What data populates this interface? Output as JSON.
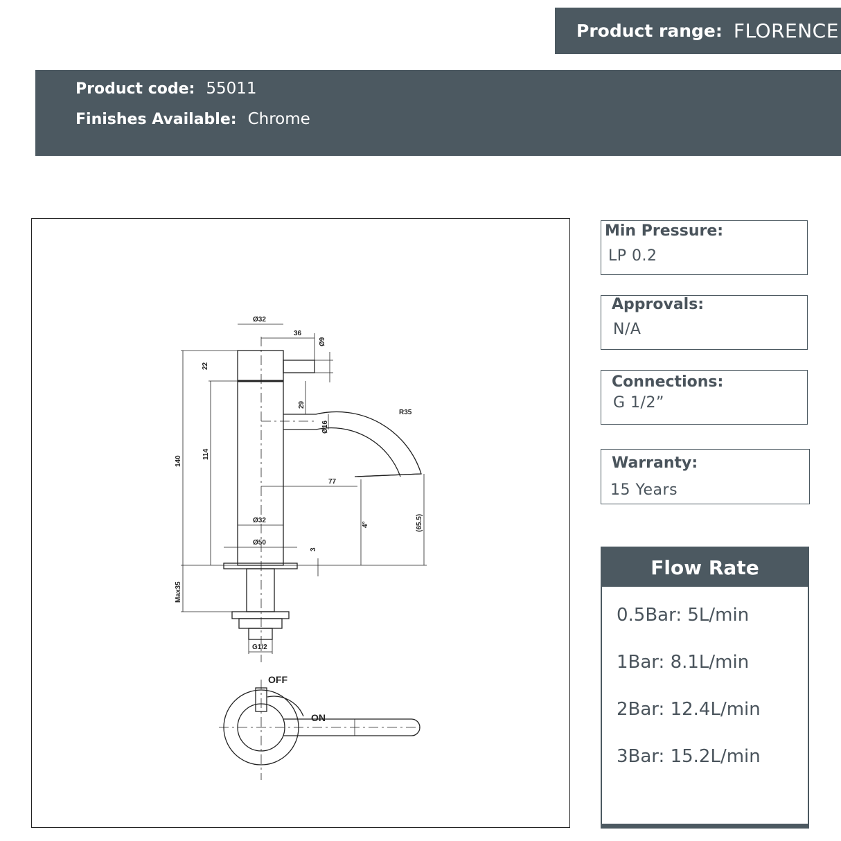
{
  "product_range": {
    "label": "Product range:",
    "value": "FLORENCE"
  },
  "product_code": {
    "label": "Product code:",
    "value": "55011"
  },
  "finishes": {
    "label": "Finishes Available:",
    "value": "Chrome"
  },
  "specs": {
    "min_pressure": {
      "label": "Min Pressure:",
      "value": "LP 0.2"
    },
    "approvals": {
      "label": "Approvals:",
      "value": "N/A"
    },
    "connections": {
      "label": "Connections:",
      "value": "G 1/2”"
    },
    "warranty": {
      "label": "Warranty:",
      "value": "15 Years"
    }
  },
  "flow_rate": {
    "title": "Flow Rate",
    "rows": [
      "0.5Bar:  5L/min",
      "1Bar:  8.1L/min",
      "2Bar:  12.4L/min",
      "3Bar:  15.2L/min"
    ]
  },
  "drawing": {
    "dims": {
      "d32_top": "Ø32",
      "d36": "36",
      "d9": "Ø9",
      "d22": "22",
      "d29": "29",
      "d16": "Ø16",
      "r35": "R35",
      "d140": "140",
      "d114": "114",
      "d77": "77",
      "d4": "4°",
      "d655": "(65.5)",
      "d32_mid": "Ø32",
      "d50": "Ø50",
      "d3": "3",
      "dmax35": "Max35",
      "g12": "G1/2"
    },
    "off": "OFF",
    "on": "ON"
  }
}
